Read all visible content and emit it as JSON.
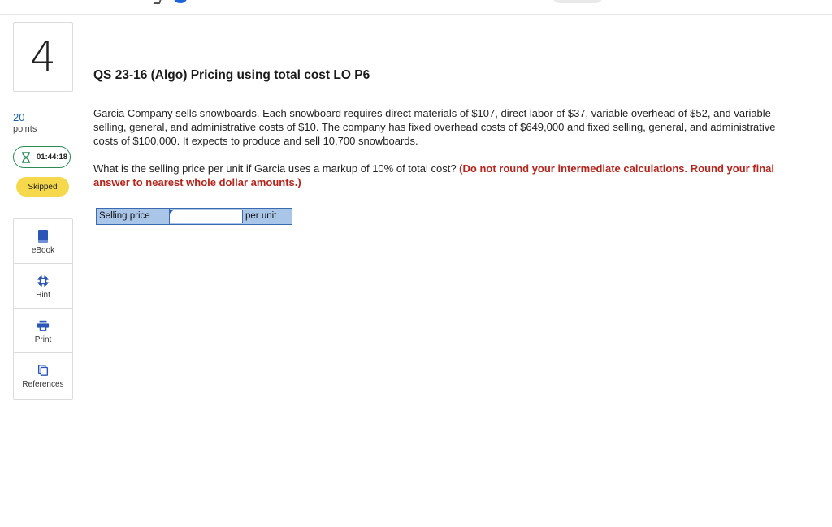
{
  "question": {
    "number": "4",
    "points_value": "20",
    "points_label": "points",
    "timer": "01:44:18",
    "status_badge": "Skipped",
    "title": "QS 23-16 (Algo) Pricing using total cost LO P6",
    "problem_text": "Garcia Company sells snowboards. Each snowboard requires direct materials of $107, direct labor of $37, variable overhead of $52, and variable selling, general, and administrative costs of $10. The company has fixed overhead costs of $649,000 and fixed selling, general, and administrative costs of $100,000. It expects to produce and sell 10,700 snowboards.",
    "prompt": "What is the selling price per unit if Garcia uses a markup of 10% of total cost?",
    "instructions": "(Do not round your intermediate calculations. Round your final answer to nearest whole dollar amounts.)"
  },
  "answer": {
    "label": "Selling price",
    "value": "",
    "unit": "per unit"
  },
  "tools": [
    {
      "label": "eBook",
      "icon": "book-icon"
    },
    {
      "label": "Hint",
      "icon": "lifebuoy-icon"
    },
    {
      "label": "Print",
      "icon": "printer-icon"
    },
    {
      "label": "References",
      "icon": "copy-icon"
    }
  ],
  "colors": {
    "accent_blue": "#1c64d6",
    "points_blue": "#1a5fa8",
    "timer_green": "#2d8a55",
    "skipped_yellow": "#f5d84b",
    "instruction_red": "#b3261e",
    "answer_table_bg": "#a9c5e8"
  }
}
